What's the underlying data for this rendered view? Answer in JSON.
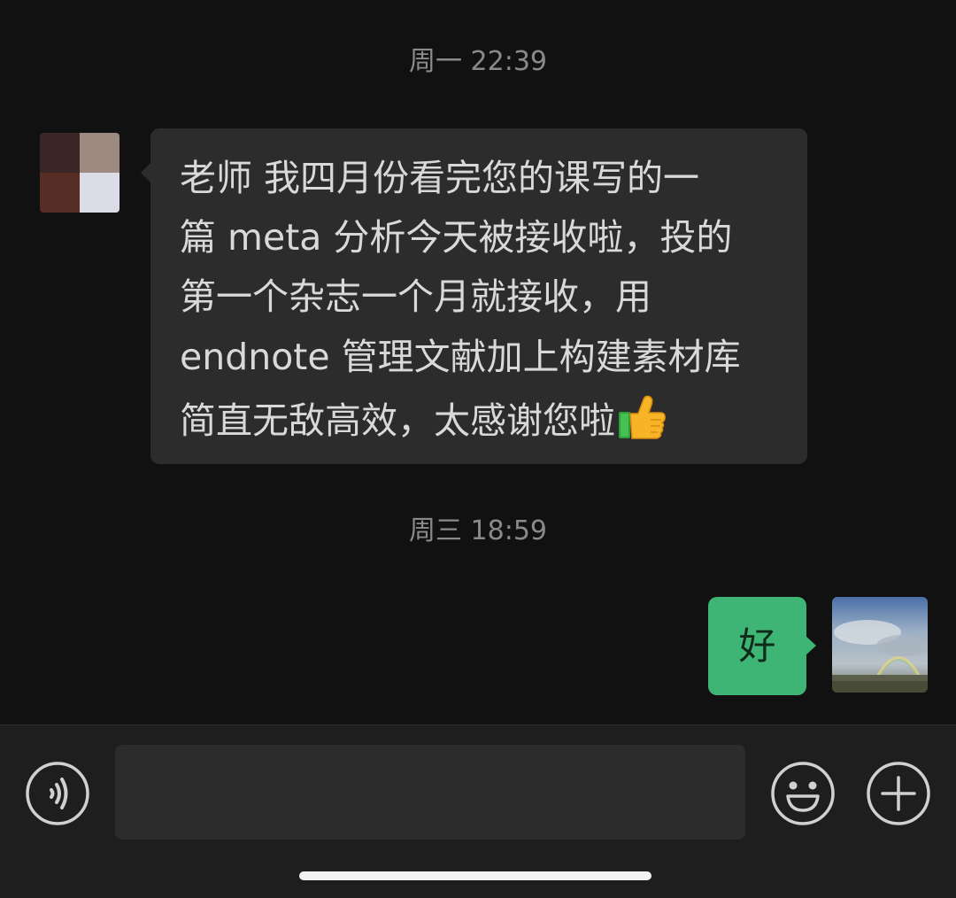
{
  "conversation": {
    "timestamps": [
      "周一 22:39",
      "周三 18:59"
    ],
    "incoming_message": {
      "lines": [
        "老师 我四月份看完您的课写的一",
        "篇 meta 分析今天被接收啦，投的",
        "第一个杂志一个月就接收，用",
        "endnote 管理文献加上构建素材库",
        "简直无敌高效，太感谢您啦"
      ],
      "trailing_emoji": "thumbs-up-icon"
    },
    "outgoing_message": {
      "text": "好"
    }
  },
  "input_bar": {
    "value": "",
    "placeholder": "",
    "icons": [
      "voice-icon",
      "emoji-icon",
      "plus-icon"
    ]
  },
  "colors": {
    "background": "#111111",
    "incoming_bubble": "#2c2c2c",
    "outgoing_bubble": "#3eb575",
    "input_bar": "#1e1e1e"
  }
}
